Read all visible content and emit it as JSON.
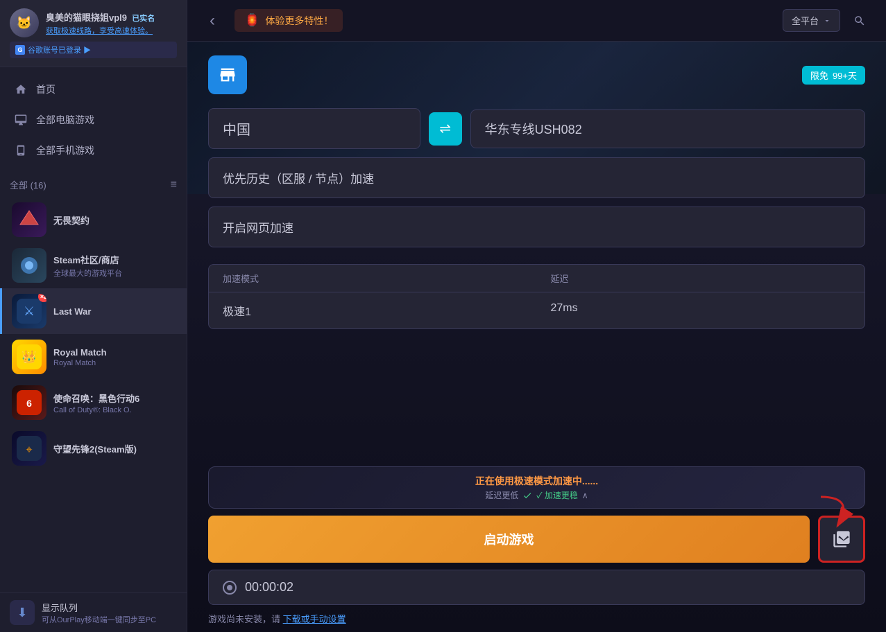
{
  "user": {
    "name": "臭美的猫眼挠姐vpl9",
    "verified_label": "已实名",
    "promo_text": "获取极速线路，享受高速体验。",
    "google_text": "谷歌账号已登录 ▶"
  },
  "nav": {
    "home_label": "首页",
    "pc_games_label": "全部电脑游戏",
    "mobile_games_label": "全部手机游戏"
  },
  "games_section": {
    "header_label": "全部 (16)",
    "items": [
      {
        "name": "无畏契约",
        "sub": "",
        "icon_type": "wuhui",
        "icon_char": "🎯"
      },
      {
        "name": "Steam社区/商店",
        "sub": "全球最大的游戏平台",
        "icon_type": "steam",
        "icon_char": "🎮"
      },
      {
        "name": "Last War",
        "sub": "",
        "icon_type": "lastwar",
        "icon_char": "⚔"
      },
      {
        "name": "Royal Match",
        "sub": "Royal Match",
        "icon_type": "royalmatch",
        "icon_char": "👑"
      },
      {
        "name": "使命召唤：黑色行动6",
        "sub": "Call of Duty®: Black O.",
        "icon_type": "cod",
        "icon_char": "🔫"
      },
      {
        "name": "守望先锋2(Steam版)",
        "sub": "",
        "icon_type": "overwatch",
        "icon_char": "🛡"
      }
    ]
  },
  "display_queue": {
    "name": "显示队列",
    "sub": "可从OurPlay移动端一键同步至PC"
  },
  "topbar": {
    "back_label": "‹",
    "promo_label": "体验更多特性！",
    "platform_label": "全平台",
    "search_placeholder": "搜索"
  },
  "vpn": {
    "promo_badge_label": "限免",
    "promo_badge_days": "99+天",
    "region_label": "中国",
    "server_label": "华东专线USH082",
    "priority_label": "优先历史（区服 / 节点）加速",
    "webpage_label": "开启网页加速",
    "speed_mode_col": "加速模式",
    "latency_col": "延迟",
    "speed_mode_value": "极速1",
    "latency_value": "27ms"
  },
  "accel_status": {
    "title": "正在使用极速模式加速中......",
    "sub_prefix": "延迟更低",
    "sub_badge": "✓ 加速更稳",
    "sub_chevron": "∧"
  },
  "controls": {
    "launch_label": "启动游戏",
    "screenshot_icon": "⬜",
    "timer_value": "00:00:02"
  },
  "install_notice": {
    "prefix": "游戏尚未安装，请",
    "link_text": "下载或手动设置"
  }
}
